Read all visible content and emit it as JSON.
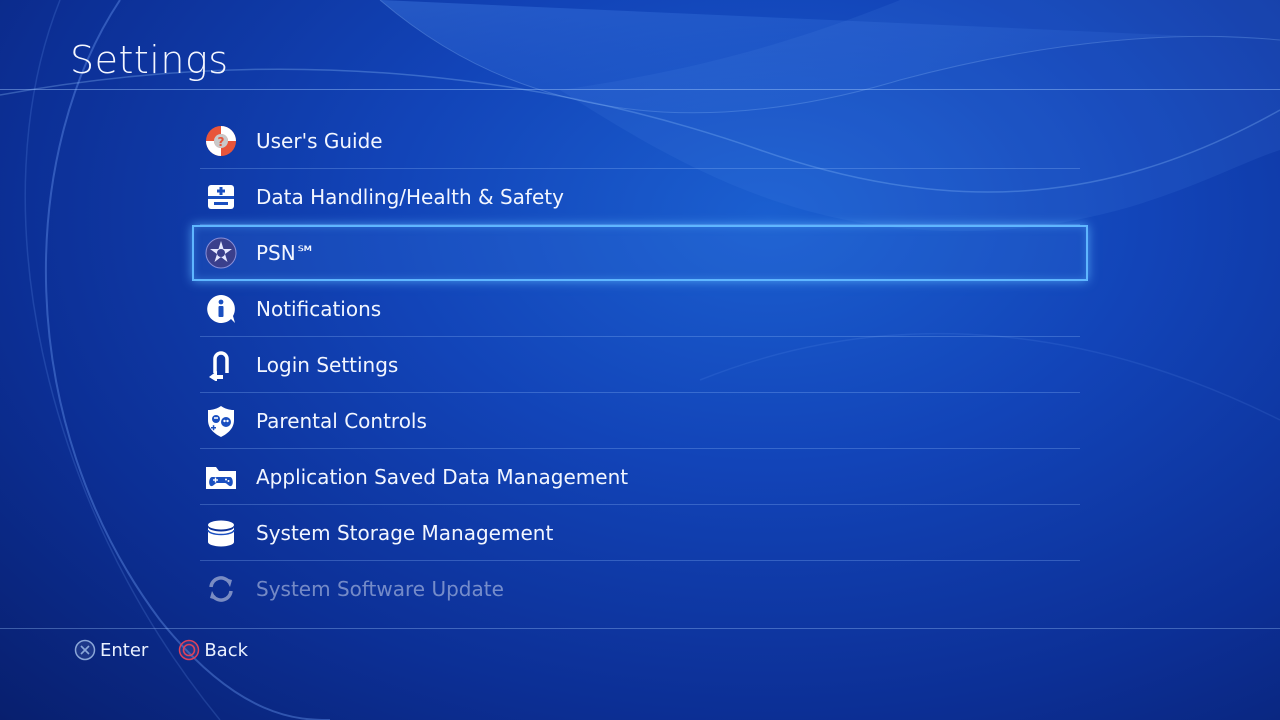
{
  "header": {
    "title": "Settings"
  },
  "menu": {
    "items": [
      {
        "label": "User's Guide",
        "icon": "lifebuoy-icon"
      },
      {
        "label": "Data Handling/Health & Safety",
        "icon": "first-aid-icon"
      },
      {
        "label": "PSN℠",
        "icon": "psn-icon"
      },
      {
        "label": "Notifications",
        "icon": "info-bubble-icon"
      },
      {
        "label": "Login Settings",
        "icon": "login-icon"
      },
      {
        "label": "Parental Controls",
        "icon": "parental-shield-icon"
      },
      {
        "label": "Application Saved Data Management",
        "icon": "controller-folder-icon"
      },
      {
        "label": "System Storage Management",
        "icon": "storage-icon"
      },
      {
        "label": "System Software Update",
        "icon": "update-icon"
      }
    ],
    "selected_index": 2
  },
  "footer": {
    "enter_label": "Enter",
    "back_label": "Back"
  },
  "colors": {
    "accent": "#5fb6ff",
    "background": "#1244b8",
    "cross_button": "#8aa6d8",
    "circle_button": "#e0405a"
  }
}
